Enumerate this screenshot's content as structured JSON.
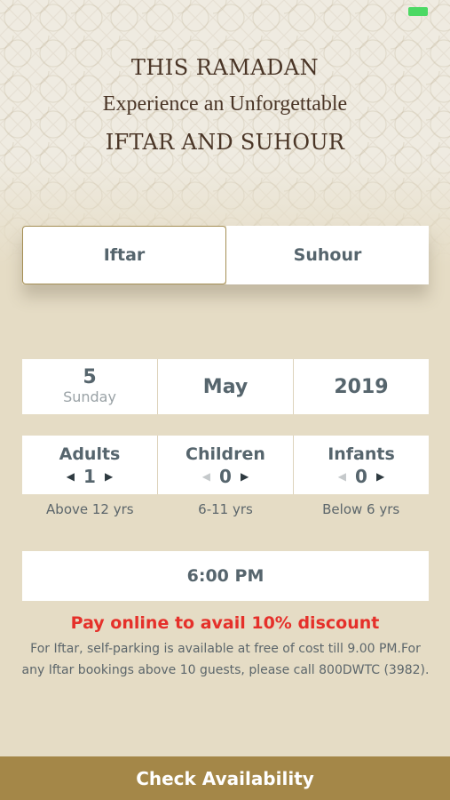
{
  "colors": {
    "background": "#e5dcc5",
    "accent_gold": "#a48748",
    "promo_red": "#e5302a",
    "title_brown": "#4a3526",
    "battery_green": "#4cd964"
  },
  "status_bar": {
    "battery_icon": "battery-icon"
  },
  "header": {
    "line1": "THIS RAMADAN",
    "line2": "Experience an Unforgettable",
    "line3": "IFTAR AND SUHOUR"
  },
  "tabs": [
    {
      "label": "Iftar",
      "active": true
    },
    {
      "label": "Suhour",
      "active": false
    }
  ],
  "date": {
    "day_number": "5",
    "day_name": "Sunday",
    "month": "May",
    "year": "2019"
  },
  "guests": [
    {
      "label": "Adults",
      "count": "1",
      "age_note": "Above 12 yrs",
      "decrement_enabled": true
    },
    {
      "label": "Children",
      "count": "0",
      "age_note": "6-11 yrs",
      "decrement_enabled": false
    },
    {
      "label": "Infants",
      "count": "0",
      "age_note": "Below 6 yrs",
      "decrement_enabled": false
    }
  ],
  "time": "6:00 PM",
  "promo": "Pay online to avail 10% discount",
  "note": "For Iftar, self-parking is available at free of cost till 9.00 PM.For any Iftar bookings above 10 guests, please call 800DWTC (3982).",
  "cta": "Check Availability"
}
